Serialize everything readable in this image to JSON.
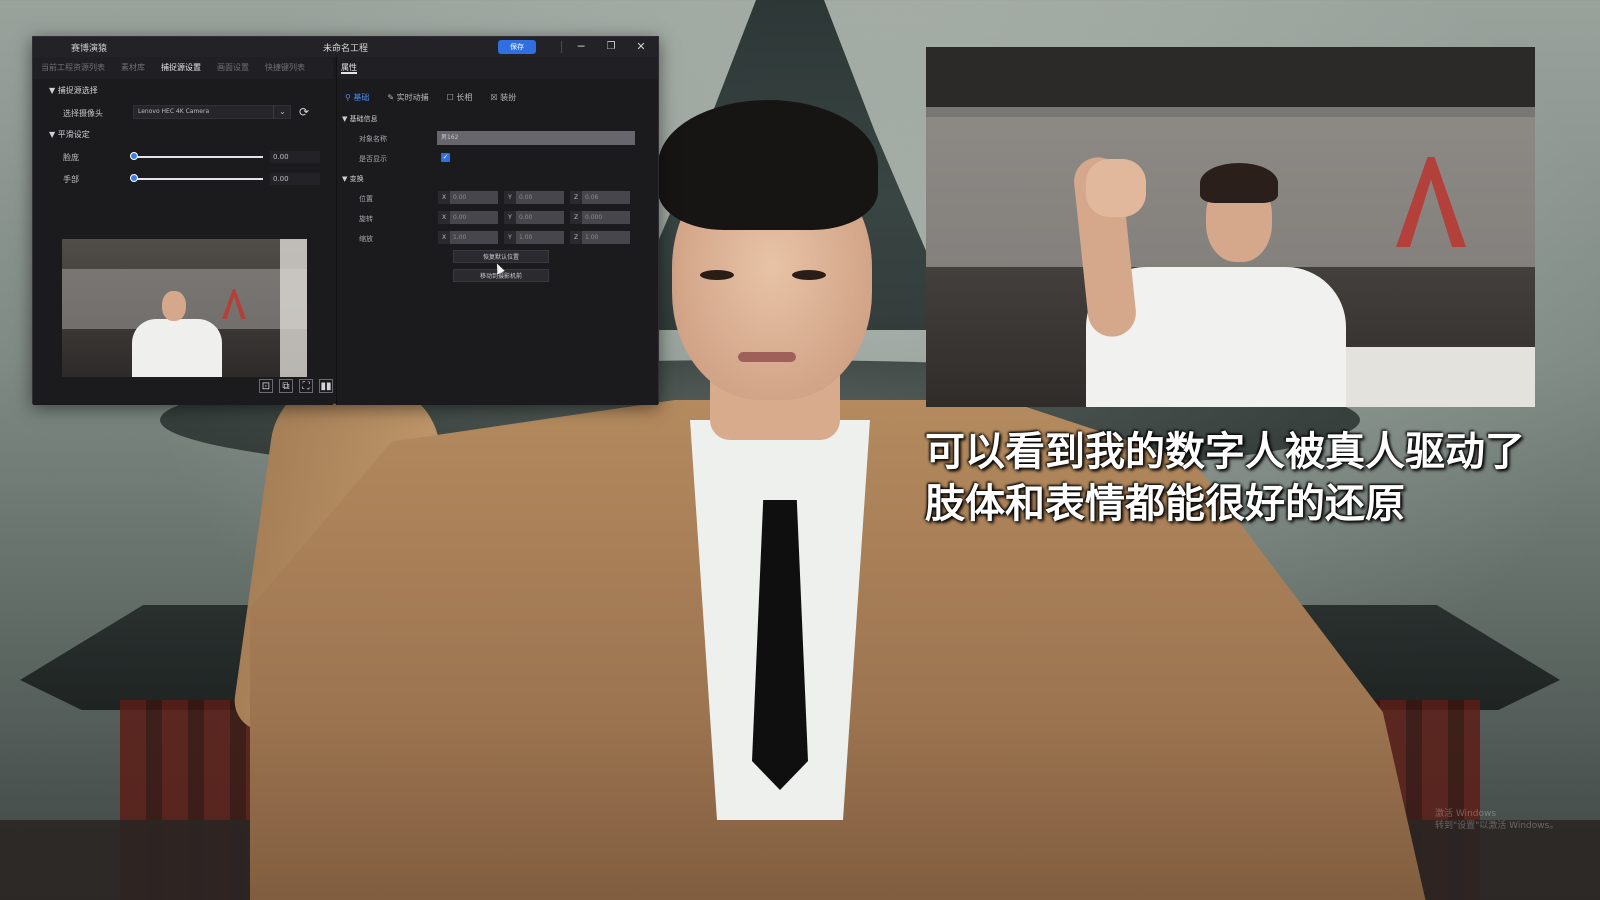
{
  "app": {
    "name": "赛博演猿",
    "window_title": "未命名工程",
    "save_label": "保存",
    "window_controls": {
      "minimize": "─",
      "maximize": "❐",
      "close": "✕"
    }
  },
  "left_panel": {
    "tabs": [
      "当前工程资源列表",
      "素材库",
      "捕捉源设置",
      "画面设置",
      "快捷键列表"
    ],
    "active_tab": "捕捉源设置",
    "capture_source": {
      "section_title": "捕捉源选择",
      "camera_label": "选择摄像头",
      "camera_value": "Lenovo HEC 4K Camera"
    },
    "smoothing": {
      "section_title": "平滑设定",
      "face_label": "脸庞",
      "face_value": "0.00",
      "hand_label": "手部",
      "hand_value": "0.00"
    },
    "preview_tools": [
      "person-frame-icon",
      "copy-icon",
      "fit-screen-icon",
      "split-view-icon"
    ]
  },
  "right_panel": {
    "header": "属性",
    "subtabs": [
      "基础",
      "实时动捕",
      "长相",
      "装扮"
    ],
    "active_subtab": "基础",
    "basic_info": {
      "group_title": "基础信息",
      "object_name_label": "对象名称",
      "object_name_value": "男162",
      "visible_label": "是否显示",
      "visible": true
    },
    "transform": {
      "group_title": "变换",
      "position_label": "位置",
      "position": {
        "x": "0.00",
        "y": "0.00",
        "z": "0.06"
      },
      "rotation_label": "旋转",
      "rotation": {
        "x": "0.00",
        "y": "0.00",
        "z": "0.000"
      },
      "scale_label": "缩放",
      "scale": {
        "x": "1.00",
        "y": "1.00",
        "z": "1.00"
      }
    },
    "reset_button": "恢复默认位置",
    "move_to_camera_button": "移动到摄影机前"
  },
  "subtitles": [
    "可以看到我的数字人被真人驱动了",
    "肢体和表情都能很好的还原"
  ],
  "watermark": {
    "line1": "激活 Windows",
    "line2": "转到\"设置\"以激活 Windows。"
  },
  "colors": {
    "accent": "#2f6fe0",
    "panel_bg": "#1b1b1d",
    "subtitle": "#ffffff"
  }
}
